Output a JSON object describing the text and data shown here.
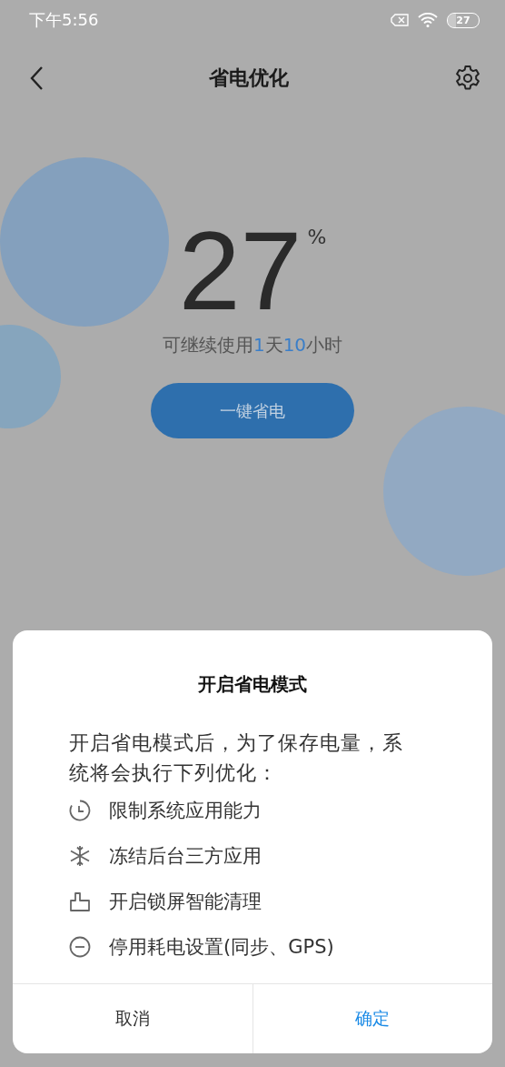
{
  "status_bar": {
    "time": "下午5:56",
    "battery": {
      "text": "27",
      "level": 0.27
    }
  },
  "header": {
    "title": "省电优化"
  },
  "battery": {
    "percent": "27",
    "unit": "%",
    "remaining": [
      {
        "text": "可继续使用",
        "highlight": false
      },
      {
        "text": "1",
        "highlight": true
      },
      {
        "text": "天",
        "highlight": false
      },
      {
        "text": "10",
        "highlight": true
      },
      {
        "text": "小时",
        "highlight": false
      }
    ],
    "button": "一键省电"
  },
  "dialog": {
    "title": "开启省电模式",
    "message": "开启省电模式后，为了保存电量，系统将会执行下列优化：",
    "items": [
      {
        "kind": "clock",
        "text": "限制系统应用能力"
      },
      {
        "kind": "snowflake",
        "text": "冻结后台三方应用"
      },
      {
        "kind": "broom",
        "text": "开启锁屏智能清理"
      },
      {
        "kind": "minus",
        "text": "停用耗电设置(同步、GPS)"
      }
    ],
    "buttons": [
      {
        "label": "取消",
        "primary": false
      },
      {
        "label": "确定",
        "primary": true
      }
    ]
  }
}
